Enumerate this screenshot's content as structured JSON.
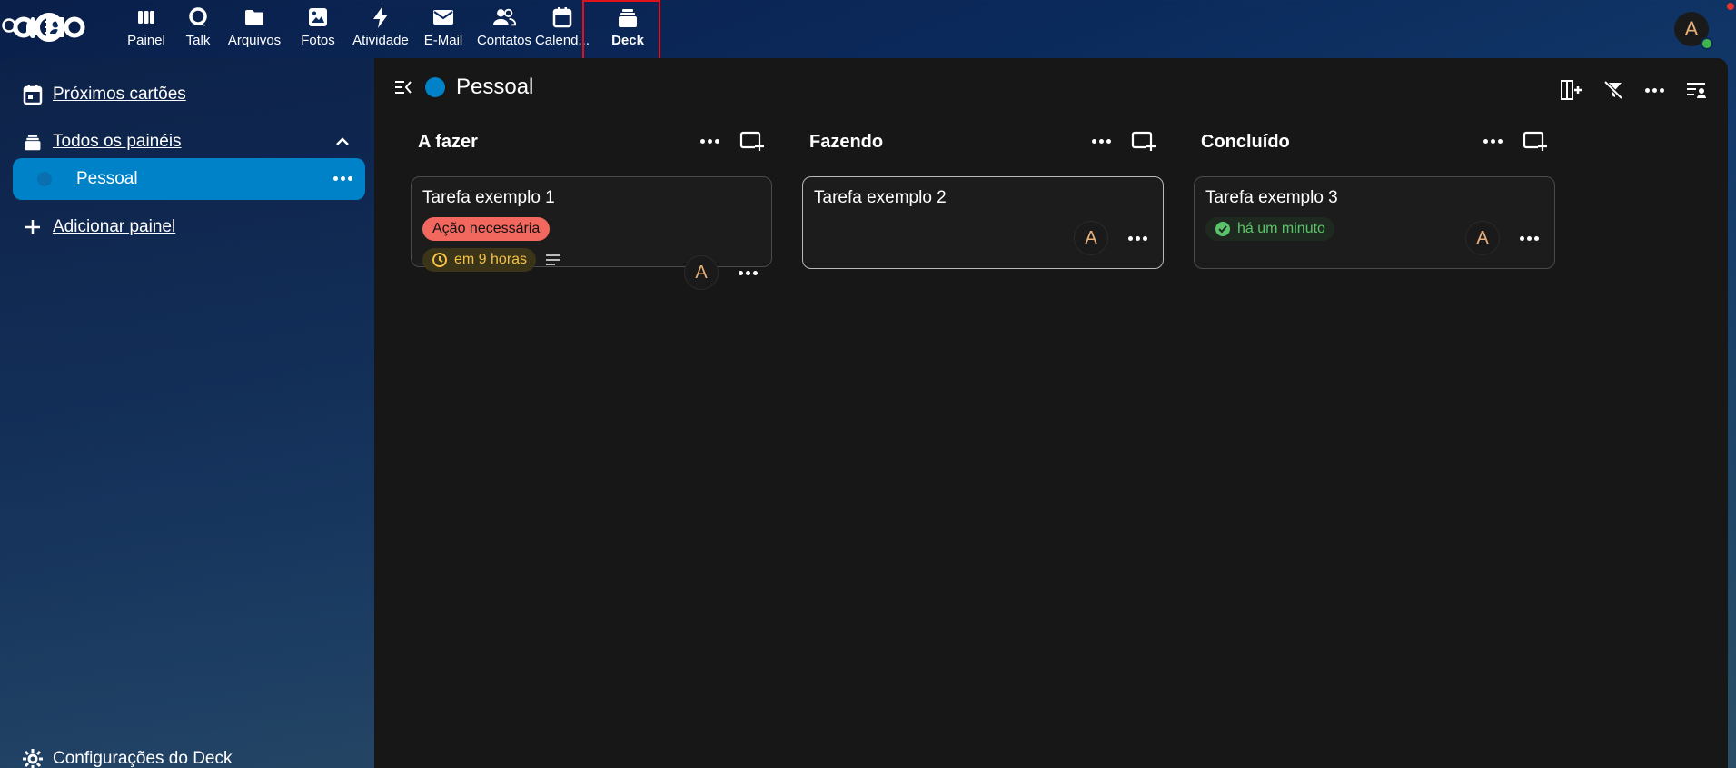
{
  "topbar": {
    "apps": [
      {
        "label": "Painel",
        "icon": "dashboard-icon"
      },
      {
        "label": "Talk",
        "icon": "talk-icon"
      },
      {
        "label": "Arquivos",
        "icon": "folder-icon"
      },
      {
        "label": "Fotos",
        "icon": "photos-icon"
      },
      {
        "label": "Atividade",
        "icon": "activity-icon"
      },
      {
        "label": "E-Mail",
        "icon": "mail-icon"
      },
      {
        "label": "Contatos",
        "icon": "contacts-icon"
      },
      {
        "label": "Calend...",
        "icon": "calendar-icon"
      },
      {
        "label": "Deck",
        "icon": "deck-icon",
        "active": true
      }
    ],
    "user_initial": "A"
  },
  "sidebar": {
    "items": [
      {
        "label": "Próximos cartões",
        "icon": "calendar-today-icon"
      },
      {
        "label": "Todos os painéis",
        "icon": "deck-icon"
      },
      {
        "label": "Pessoal",
        "icon": "board-color-dot"
      },
      {
        "label": "Adicionar painel",
        "icon": "plus-icon"
      }
    ],
    "settings_label": "Configurações do Deck"
  },
  "board": {
    "title": "Pessoal",
    "color": "#0082c9",
    "columns": [
      {
        "title": "A fazer",
        "cards": [
          {
            "title": "Tarefa exemplo 1",
            "label": "Ação necessária",
            "due": "em 9 horas",
            "assignee": "A"
          }
        ]
      },
      {
        "title": "Fazendo",
        "cards": [
          {
            "title": "Tarefa exemplo 2",
            "assignee": "A"
          }
        ]
      },
      {
        "title": "Concluído",
        "cards": [
          {
            "title": "Tarefa exemplo 3",
            "done": "há um minuto",
            "assignee": "A"
          }
        ]
      }
    ]
  },
  "colors": {
    "accent": "#0082c9",
    "label_red": "#f2675e",
    "due_yellow": "#f5c242",
    "done_green": "#5bc46a",
    "highlight_red": "#e0121b"
  }
}
